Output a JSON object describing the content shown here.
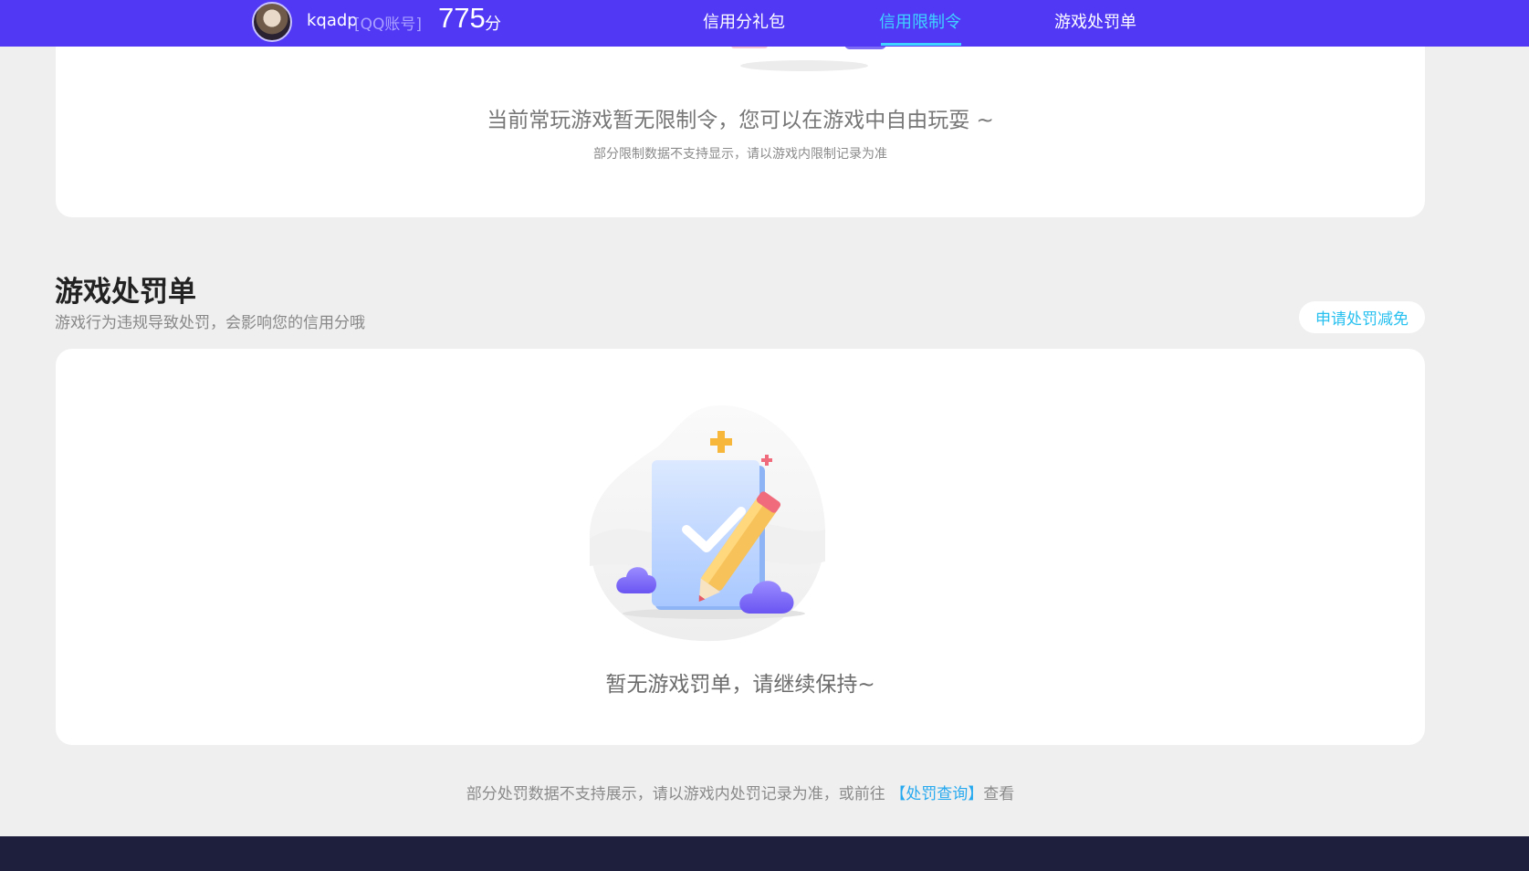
{
  "header": {
    "user_name": "kqadp",
    "account_type": "[QQ账号]",
    "score": "775",
    "score_unit": "分",
    "tabs": [
      {
        "label": "信用分礼包",
        "active": false
      },
      {
        "label": "信用限制令",
        "active": true
      },
      {
        "label": "游戏处罚单",
        "active": false
      }
    ]
  },
  "restriction_card": {
    "empty_title": "当前常玩游戏暂无限制令，您可以在游戏中自由玩耍 ~",
    "empty_note": "部分限制数据不支持显示，请以游戏内限制记录为准"
  },
  "penalty_section": {
    "title": "游戏处罚单",
    "subtitle": "游戏行为违规导致处罚，会影响您的信用分哦",
    "appeal_button": "申请处罚减免",
    "empty_text": "暂无游戏罚单，请继续保持~"
  },
  "footer_note": {
    "text_before": "部分处罚数据不支持展示，请以游戏内处罚记录为准，或前往",
    "link": "【处罚查询】",
    "text_after": "查看"
  },
  "colors": {
    "header_bg": "#5138f5",
    "active_tab": "#3fd3ff",
    "link": "#27a9ef",
    "footer_bg": "#1e1f3d"
  }
}
